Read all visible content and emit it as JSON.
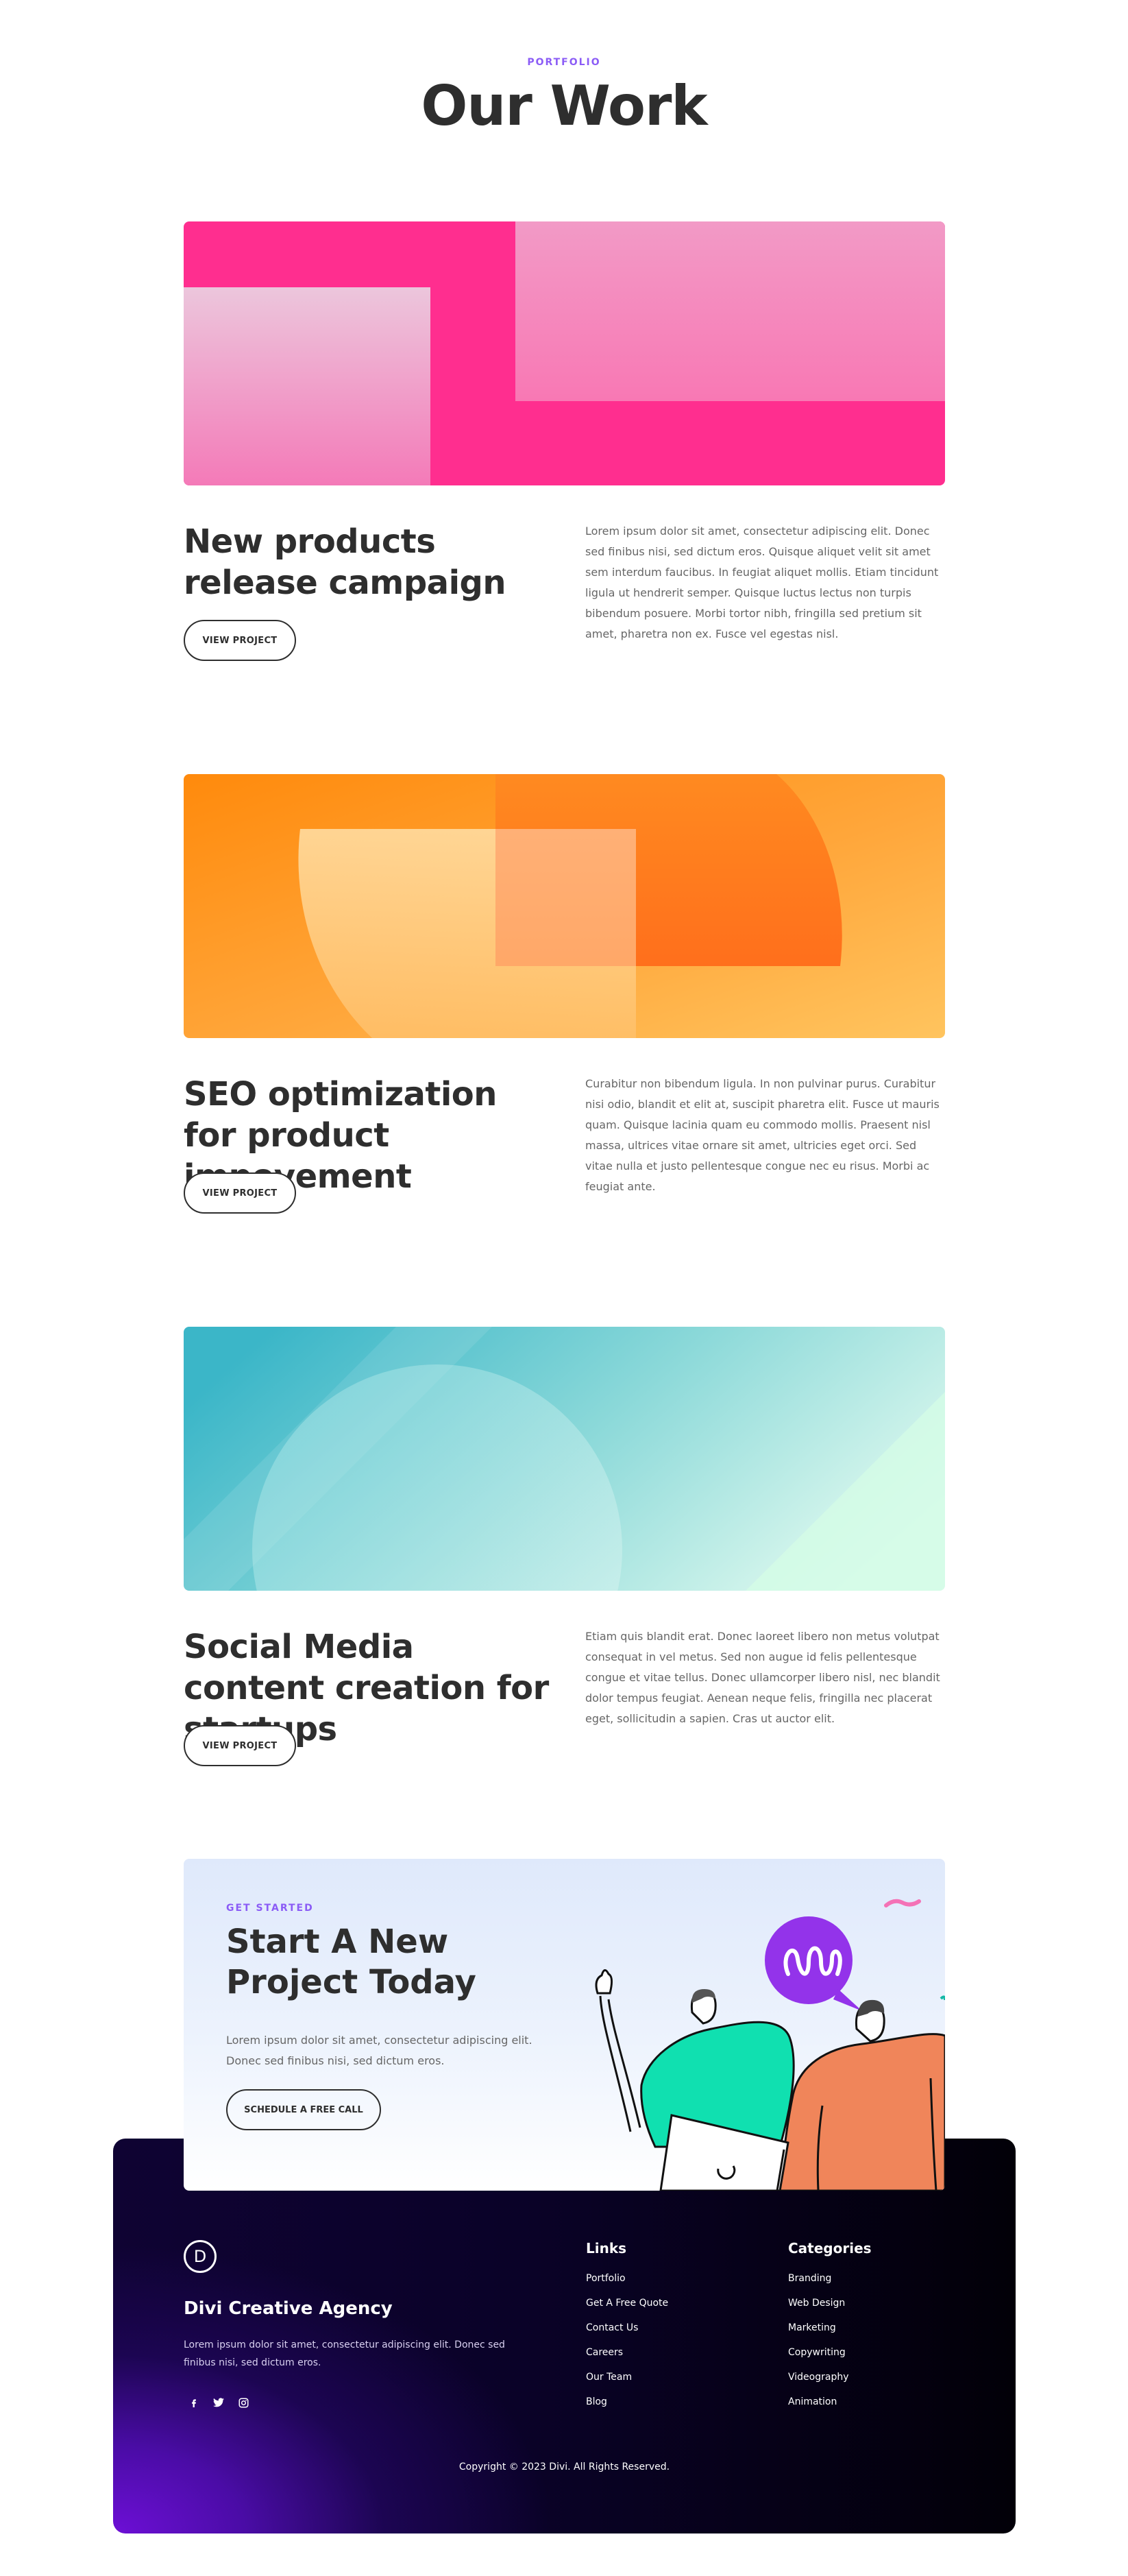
{
  "header": {
    "eyebrow": "PORTFOLIO",
    "title": "Our Work"
  },
  "projects": [
    {
      "title": "New products release campaign",
      "description": "Lorem ipsum dolor sit amet, consectetur adipiscing elit. Donec sed finibus nisi, sed dictum eros. Quisque aliquet velit sit amet sem interdum faucibus. In feugiat aliquet mollis. Etiam tincidunt ligula ut hendrerit semper. Quisque luctus lectus non turpis bibendum posuere. Morbi tortor nibh, fringilla sed pretium sit amet, pharetra non ex. Fusce vel egestas nisl.",
      "button": "VIEW PROJECT",
      "colors": {
        "base": "#ff2e8f",
        "light": "#f7a6cf"
      }
    },
    {
      "title": "SEO optimization for product impovement",
      "description": "Curabitur non bibendum ligula. In non pulvinar purus. Curabitur nisi odio, blandit et elit at, suscipit pharetra elit. Fusce ut mauris quam. Quisque lacinia quam eu commodo mollis. Praesent nisl massa, ultrices vitae ornare sit amet, ultricies eget orci. Sed vitae nulla et justo pellentesque congue nec eu risus. Morbi ac feugiat ante.",
      "button": "VIEW PROJECT",
      "colors": {
        "base": "#ff9a1f",
        "light": "#ffd59a"
      }
    },
    {
      "title": "Social Media content creation for startups",
      "description": "Etiam quis blandit erat. Donec laoreet libero non metus volutpat consequat in vel metus. Sed non augue id felis pellentesque congue et vitae tellus. Donec ullamcorper libero nisl, nec blandit dolor tempus feugiat. Aenean neque felis, fringilla nec placerat eget, sollicitudin a sapien. Cras ut auctor elit.",
      "button": "VIEW PROJECT",
      "colors": {
        "base": "#40bccb",
        "light": "#d6fbec"
      }
    }
  ],
  "cta": {
    "eyebrow": "GET STARTED",
    "title": "Start A New Project Today",
    "description": "Lorem ipsum dolor sit amet, consectetur adipiscing elit. Donec sed finibus nisi, sed dictum eros.",
    "button": "SCHEDULE A FREE CALL"
  },
  "footer": {
    "logo_letter": "D",
    "agency_name": "Divi Creative Agency",
    "description": "Lorem ipsum dolor sit amet, consectetur adipiscing elit. Donec sed finibus nisi, sed dictum eros.",
    "social_icons": [
      "facebook-icon",
      "twitter-icon",
      "instagram-icon"
    ],
    "links_heading": "Links",
    "links": [
      "Portfolio",
      "Get A Free Quote",
      "Contact Us",
      "Careers",
      "Our Team",
      "Blog"
    ],
    "categories_heading": "Categories",
    "categories": [
      "Branding",
      "Web Design",
      "Marketing",
      "Copywriting",
      "Videography",
      "Animation"
    ],
    "copyright": "Copyright © 2023 Divi. All Rights Reserved."
  }
}
